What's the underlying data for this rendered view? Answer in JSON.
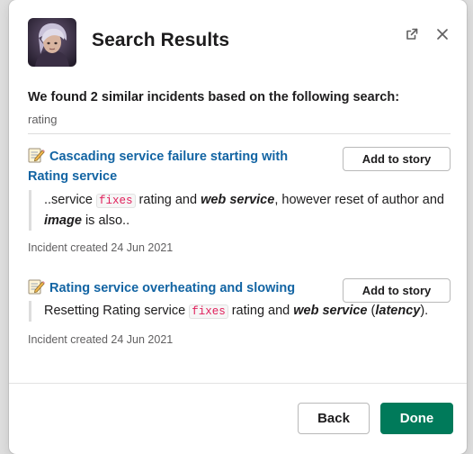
{
  "modal": {
    "title": "Search Results",
    "intro": "We found 2 similar incidents based on the following search:",
    "query": "rating"
  },
  "results": [
    {
      "title": "Cascading service failure starting with Rating service",
      "add_label": "Add to story",
      "snippet": {
        "a": "..service ",
        "code": "fixes",
        "b": " rating and ",
        "c": "web service",
        "d": ", however reset of author and ",
        "e": "image",
        "f": " is also.."
      },
      "meta": "Incident created 24 Jun 2021"
    },
    {
      "title": "Rating service overheating and slowing",
      "add_label": "Add to story",
      "snippet": {
        "a": "Resetting Rating service ",
        "code": "fixes",
        "b": " rating and ",
        "c": "web service",
        "d": " (",
        "e": "latency",
        "f": ")."
      },
      "meta": "Incident created 24 Jun 2021"
    }
  ],
  "footer": {
    "back_label": "Back",
    "done_label": "Done"
  },
  "colors": {
    "link": "#1264a3",
    "code": "#e01e5a",
    "primary": "#007a5a"
  },
  "icons": [
    "app-avatar",
    "popout-icon",
    "close-icon",
    "memo-icon"
  ]
}
